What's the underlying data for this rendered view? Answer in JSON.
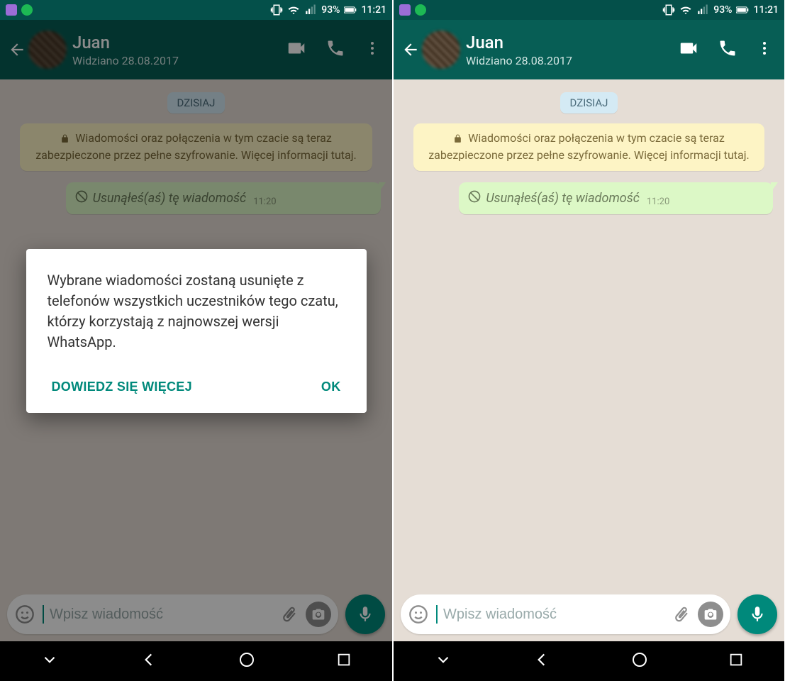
{
  "statusbar": {
    "battery": "93%",
    "time": "11:21"
  },
  "header": {
    "name": "Juan",
    "subtitle": "Widziano 28.08.2017"
  },
  "chat": {
    "day_label": "DZISIAJ",
    "encryption_notice": "Wiadomości oraz połączenia w tym czacie są teraz zabezpieczone przez pełne szyfrowanie. Więcej informacji tutaj.",
    "deleted_message": "Usunąłeś(aś) tę wiadomość",
    "deleted_time": "11:20"
  },
  "input": {
    "placeholder": "Wpisz wiadomość"
  },
  "dialog": {
    "body": "Wybrane wiadomości zostaną usunięte z telefonów wszystkich uczestników tego czatu, którzy korzystają z najnowszej wersji WhatsApp.",
    "learn_more": "DOWIEDZ SIĘ WIĘCEJ",
    "ok": "OK"
  }
}
